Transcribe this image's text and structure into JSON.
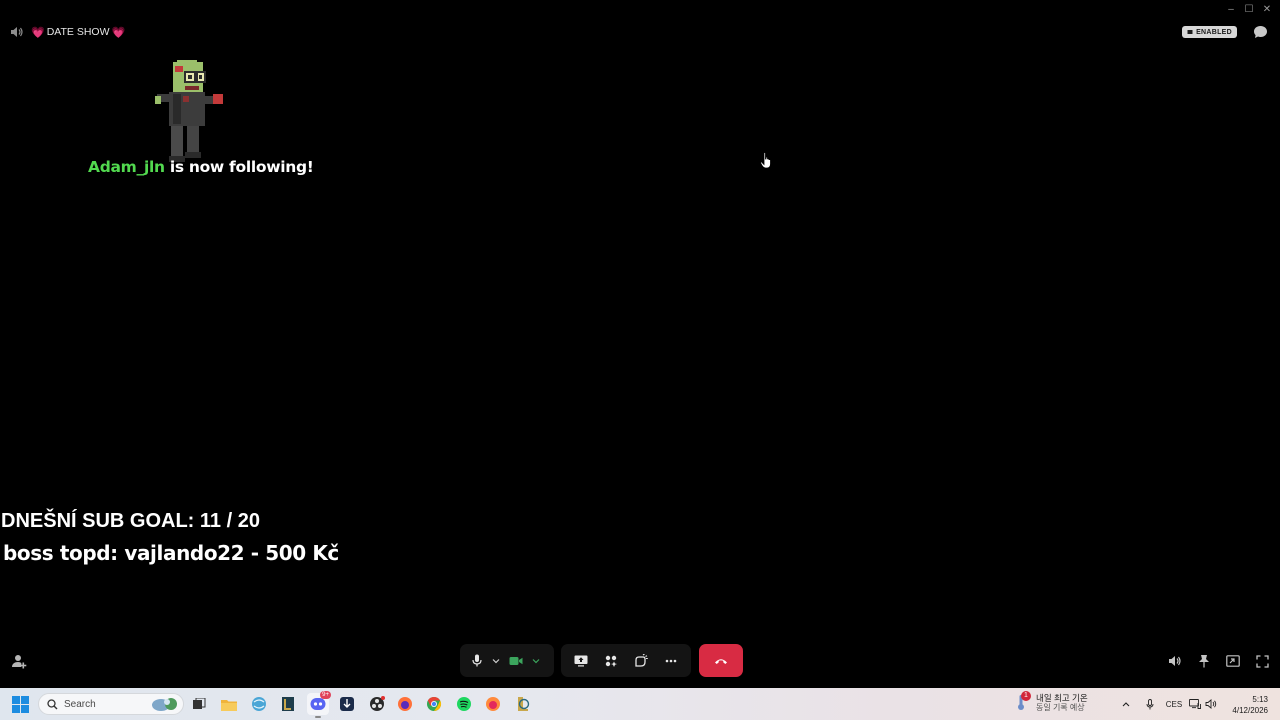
{
  "window": {
    "minimize_glyph": "–",
    "maximize_glyph": "☐",
    "close_glyph": "✕"
  },
  "topbar": {
    "title": "DATE SHOW",
    "title_icon": "heart-icon",
    "status_badge": "ENABLED"
  },
  "overlay": {
    "follow_user": "Adam_jln",
    "follow_text": " is now following!",
    "sub_goal": "DNEŠNÍ SUB GOAL: 11 / 20",
    "boss_line": "boss topd:  vajlando22 - 500 Kč"
  },
  "call_controls": {
    "left_group": [
      "microphone-icon",
      "chevron-down-icon",
      "camera-icon",
      "chevron-down-icon"
    ],
    "mid_group": [
      "screen-share-icon",
      "activities-icon",
      "soundboard-icon",
      "more-icon"
    ],
    "end_call": "end-call-icon",
    "right_group": [
      "volume-icon",
      "pin-icon",
      "pop-out-icon",
      "fullscreen-icon"
    ]
  },
  "taskbar": {
    "search_placeholder": "Search",
    "weather_badge": "1",
    "weather_line1": "내일 최고 기온",
    "weather_line2": "동일 기록 예상",
    "language": "CES",
    "time": "5:13",
    "date": "4/12/2026",
    "discord_badge": "9+",
    "colors": {
      "accent_green": "#52d94f",
      "end_call_red": "#d82b43",
      "camera_green": "#3ba55d"
    }
  }
}
